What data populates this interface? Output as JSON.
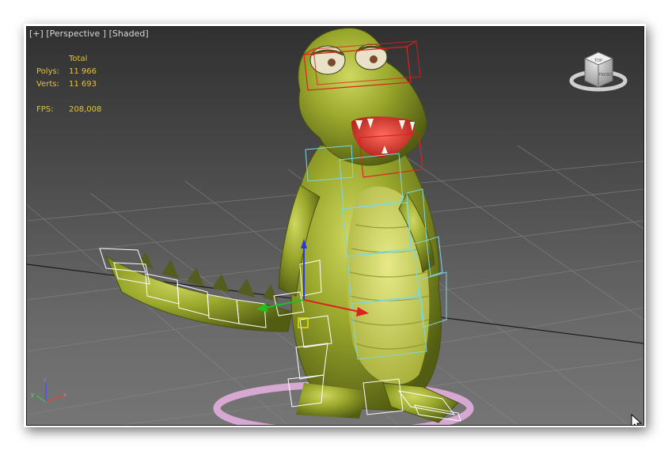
{
  "viewport": {
    "label_plus": "[+]",
    "label_view": "[Perspective ]",
    "label_shading": "[Shaded]"
  },
  "stats": {
    "header": "Total",
    "polys_label": "Polys:",
    "polys_value": "11 966",
    "verts_label": "Verts:",
    "verts_value": "11 693",
    "fps_label": "FPS:",
    "fps_value": "208,008"
  },
  "viewcube": {
    "face_labels": [
      "TOP",
      "FRONT"
    ]
  },
  "axis_gizmo": {
    "labels": [
      "z",
      "x",
      "y"
    ]
  },
  "colors": {
    "stats_text": "#e1c23f",
    "label_text": "#d6d6d6",
    "character_skin": "#9aa82c",
    "bone_box": "#ffffff",
    "selection": "#e02020",
    "biped_cyan": "#7fd7e0"
  }
}
